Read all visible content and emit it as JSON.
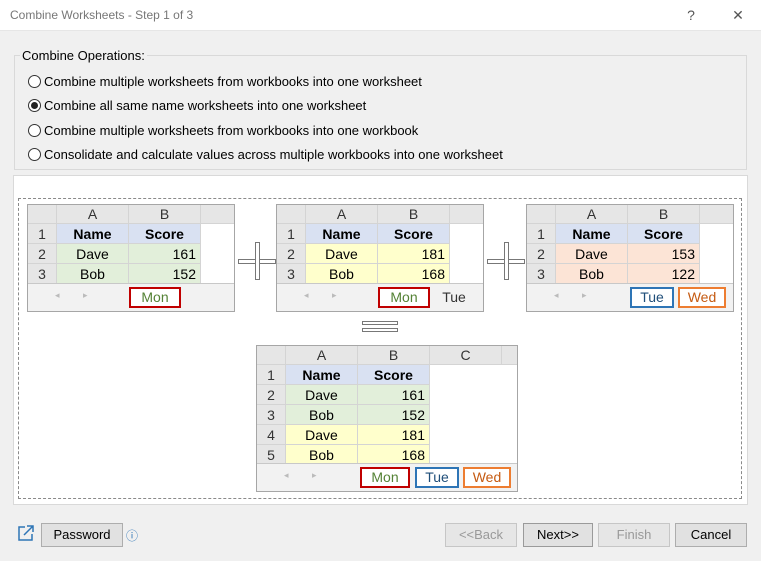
{
  "window": {
    "title": "Combine Worksheets - Step 1 of 3",
    "help": "?",
    "close": "✕"
  },
  "operations": {
    "legend": "Combine Operations:",
    "options": [
      {
        "label": "Combine multiple worksheets from workbooks into one worksheet",
        "checked": false
      },
      {
        "label": "Combine all same name worksheets into one worksheet",
        "checked": true
      },
      {
        "label": "Combine multiple worksheets from workbooks into one workbook",
        "checked": false
      },
      {
        "label": "Consolidate and calculate values across multiple workbooks into one worksheet",
        "checked": false
      }
    ]
  },
  "preview": {
    "col_headers": [
      "A",
      "B",
      "C"
    ],
    "row_headers": [
      "1",
      "2",
      "3",
      "4",
      "5"
    ],
    "header_name": "Name",
    "header_score": "Score",
    "sheet1": {
      "rows": [
        [
          "Dave",
          "161"
        ],
        [
          "Bob",
          "152"
        ]
      ],
      "tabs": [
        "Mon"
      ]
    },
    "sheet2": {
      "rows": [
        [
          "Dave",
          "181"
        ],
        [
          "Bob",
          "168"
        ]
      ],
      "tabs": [
        "Mon",
        "Tue"
      ]
    },
    "sheet3": {
      "rows": [
        [
          "Dave",
          "153"
        ],
        [
          "Bob",
          "122"
        ]
      ],
      "tabs": [
        "Tue",
        "Wed"
      ]
    },
    "result": {
      "rows": [
        [
          "Dave",
          "161"
        ],
        [
          "Bob",
          "152"
        ],
        [
          "Dave",
          "181"
        ],
        [
          "Bob",
          "168"
        ]
      ],
      "tabs": [
        "Mon",
        "Tue",
        "Wed"
      ]
    },
    "tab_colors": {
      "Mon": "#c00000",
      "Tue": "#2e75b6",
      "Wed": "#ed7d31"
    },
    "tab_text_colors": {
      "Mon": "#548235",
      "Tue": "#1f4e79",
      "Wed": "#c55a11"
    },
    "nav_prev": "◂",
    "nav_next": "▸"
  },
  "footer": {
    "link_icon": "external-link-icon",
    "password_label": "Password",
    "info_icon": "ⓘ",
    "back_label": "<<Back",
    "next_label": "Next>>",
    "finish_label": "Finish",
    "cancel_label": "Cancel"
  }
}
